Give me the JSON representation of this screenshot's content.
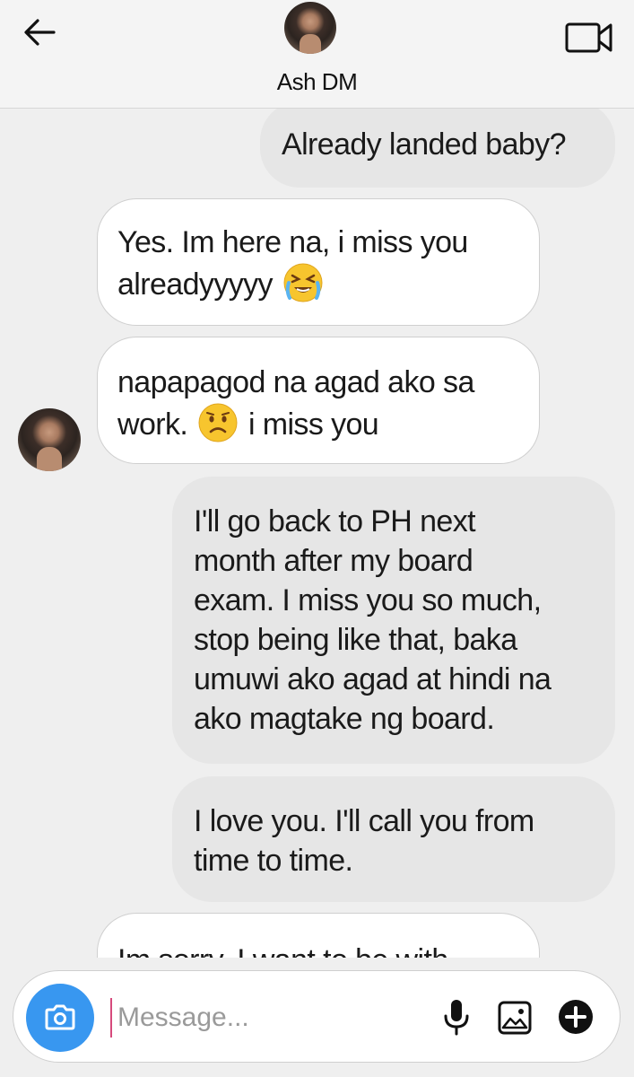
{
  "header": {
    "title": "Ash DM",
    "back_icon": "arrow-left-icon",
    "video_icon": "video-camera-icon"
  },
  "messages": [
    {
      "direction": "outgoing",
      "text": "Already landed baby?"
    },
    {
      "direction": "incoming",
      "line1": "Yes. Im here na, i miss you",
      "line2_before": "alreadyyyyy",
      "emoji": "loudly-crying-face-emoji"
    },
    {
      "direction": "incoming",
      "line1": "napapagod na agad ako sa",
      "line2_before": "work.",
      "emoji": "worried-face-emoji",
      "line2_after": "i miss you"
    },
    {
      "direction": "outgoing",
      "lines": [
        "I'll go back to PH next",
        "month after my board",
        "exam. I miss you so much,",
        "stop being like that, baka",
        "umuwi ako agad at hindi na",
        "ako magtake ng board."
      ]
    },
    {
      "direction": "outgoing",
      "lines": [
        "I love you. I'll call you from",
        "time to time."
      ]
    },
    {
      "direction": "incoming",
      "partial_text": "Im sorry. I want to be with"
    }
  ],
  "composer": {
    "placeholder": "Message...",
    "value": "",
    "camera_icon": "camera-icon",
    "mic_icon": "microphone-icon",
    "gallery_icon": "image-gallery-icon",
    "plus_icon": "plus-circle-icon"
  },
  "colors": {
    "background": "#efefef",
    "outgoing_bubble": "#e6e6e6",
    "incoming_bubble": "#ffffff",
    "camera_button": "#3897f0",
    "cursor": "#d64a7c"
  }
}
